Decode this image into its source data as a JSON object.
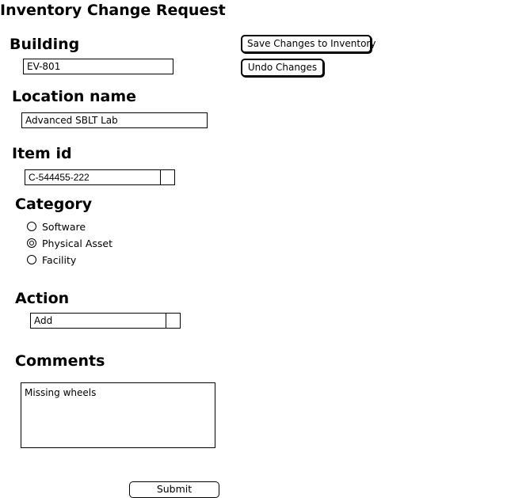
{
  "page": {
    "title": "Inventory Change Request"
  },
  "toolbar": {
    "save_label": "Save Changes to Inventory",
    "undo_label": "Undo Changes"
  },
  "building": {
    "label": "Building",
    "value": "EV-801"
  },
  "location": {
    "label": "Location name",
    "value": "Advanced SBLT Lab"
  },
  "item": {
    "label": "Item id",
    "value": "C-544455-222"
  },
  "category": {
    "label": "Category",
    "options": [
      {
        "label": "Software",
        "selected": false
      },
      {
        "label": "Physical Asset",
        "selected": true
      },
      {
        "label": "Facility",
        "selected": false
      }
    ]
  },
  "action": {
    "label": "Action",
    "value": "Add"
  },
  "comments": {
    "label": "Comments",
    "value": "Missing wheels"
  },
  "submit": {
    "label": "Submit"
  }
}
